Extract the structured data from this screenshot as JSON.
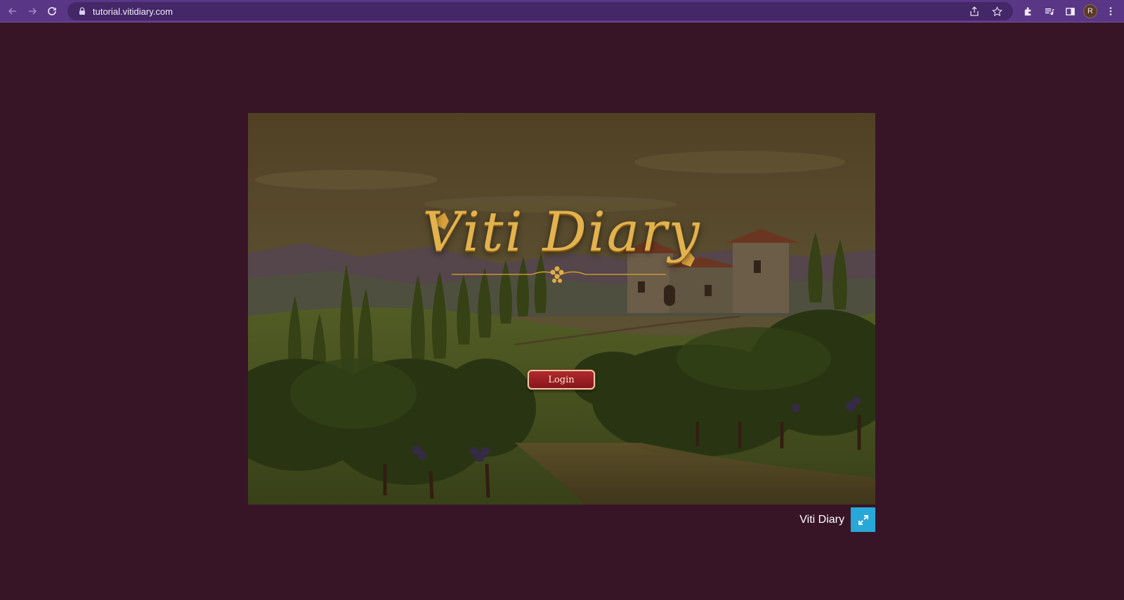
{
  "browser": {
    "url": "tutorial.vitidiary.com",
    "profile_initial": "R",
    "theme_color": "#5a3686"
  },
  "game": {
    "logo_text": "Viti Diary",
    "login_label": "Login"
  },
  "footer": {
    "title": "Viti Diary",
    "fullscreen_color": "#27a8d8"
  },
  "colors": {
    "page_background": "#371527",
    "logo_gold": "#e2b24e",
    "login_red": "#9a1e24"
  }
}
